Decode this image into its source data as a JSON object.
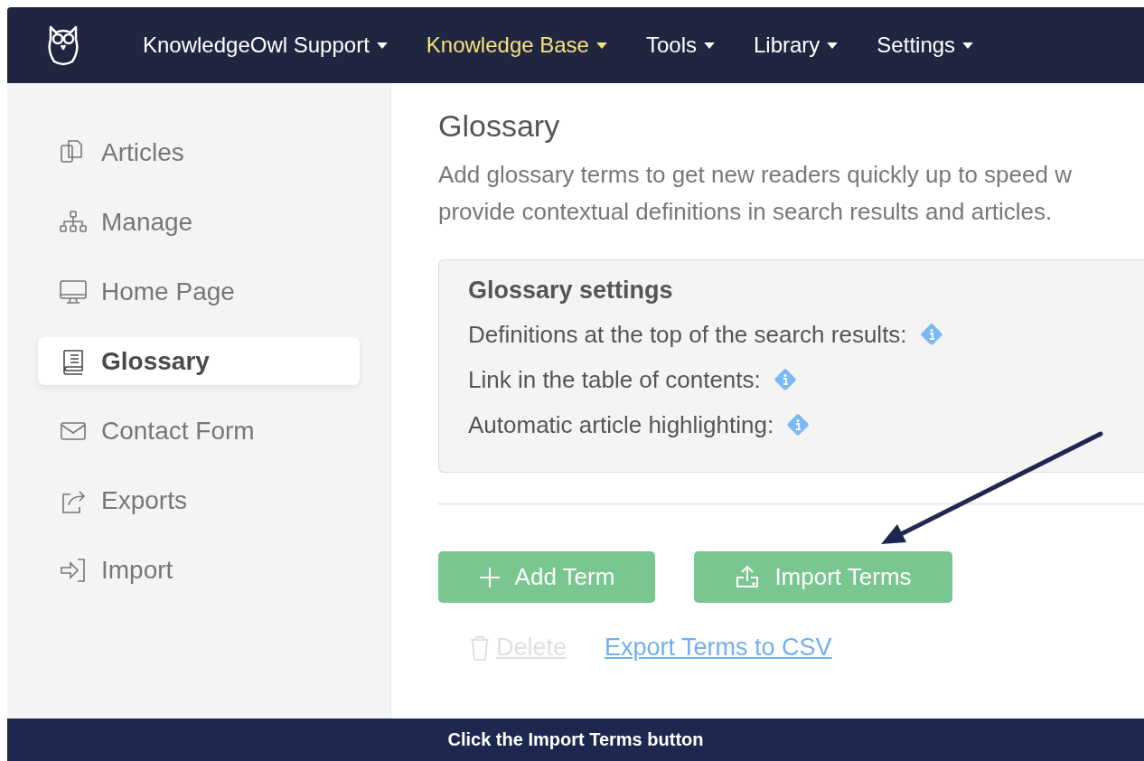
{
  "nav": [
    {
      "label": "KnowledgeOwl Support",
      "selected": false
    },
    {
      "label": "Knowledge Base",
      "selected": true
    },
    {
      "label": "Tools",
      "selected": false
    },
    {
      "label": "Library",
      "selected": false
    },
    {
      "label": "Settings",
      "selected": false
    }
  ],
  "sidebar": {
    "items": [
      {
        "label": "Articles",
        "selected": false
      },
      {
        "label": "Manage",
        "selected": false
      },
      {
        "label": "Home Page",
        "selected": false
      },
      {
        "label": "Glossary",
        "selected": true
      },
      {
        "label": "Contact Form",
        "selected": false
      },
      {
        "label": "Exports",
        "selected": false
      },
      {
        "label": "Import",
        "selected": false
      }
    ]
  },
  "page": {
    "title": "Glossary",
    "description": [
      "Add glossary terms to get new readers quickly up to speed w",
      "provide contextual definitions in search results and articles."
    ]
  },
  "settings": {
    "title": "Glossary settings",
    "rows": [
      "Definitions at the top of the search results:",
      "Link in the table of contents:",
      "Automatic article highlighting:"
    ]
  },
  "buttons": [
    {
      "label": "Add Term"
    },
    {
      "label": "Import Terms"
    }
  ],
  "links": [
    {
      "label": "Delete",
      "disabled": true
    },
    {
      "label": "Export Terms to CSV",
      "disabled": false
    }
  ],
  "caption": "Click the Import Terms button"
}
